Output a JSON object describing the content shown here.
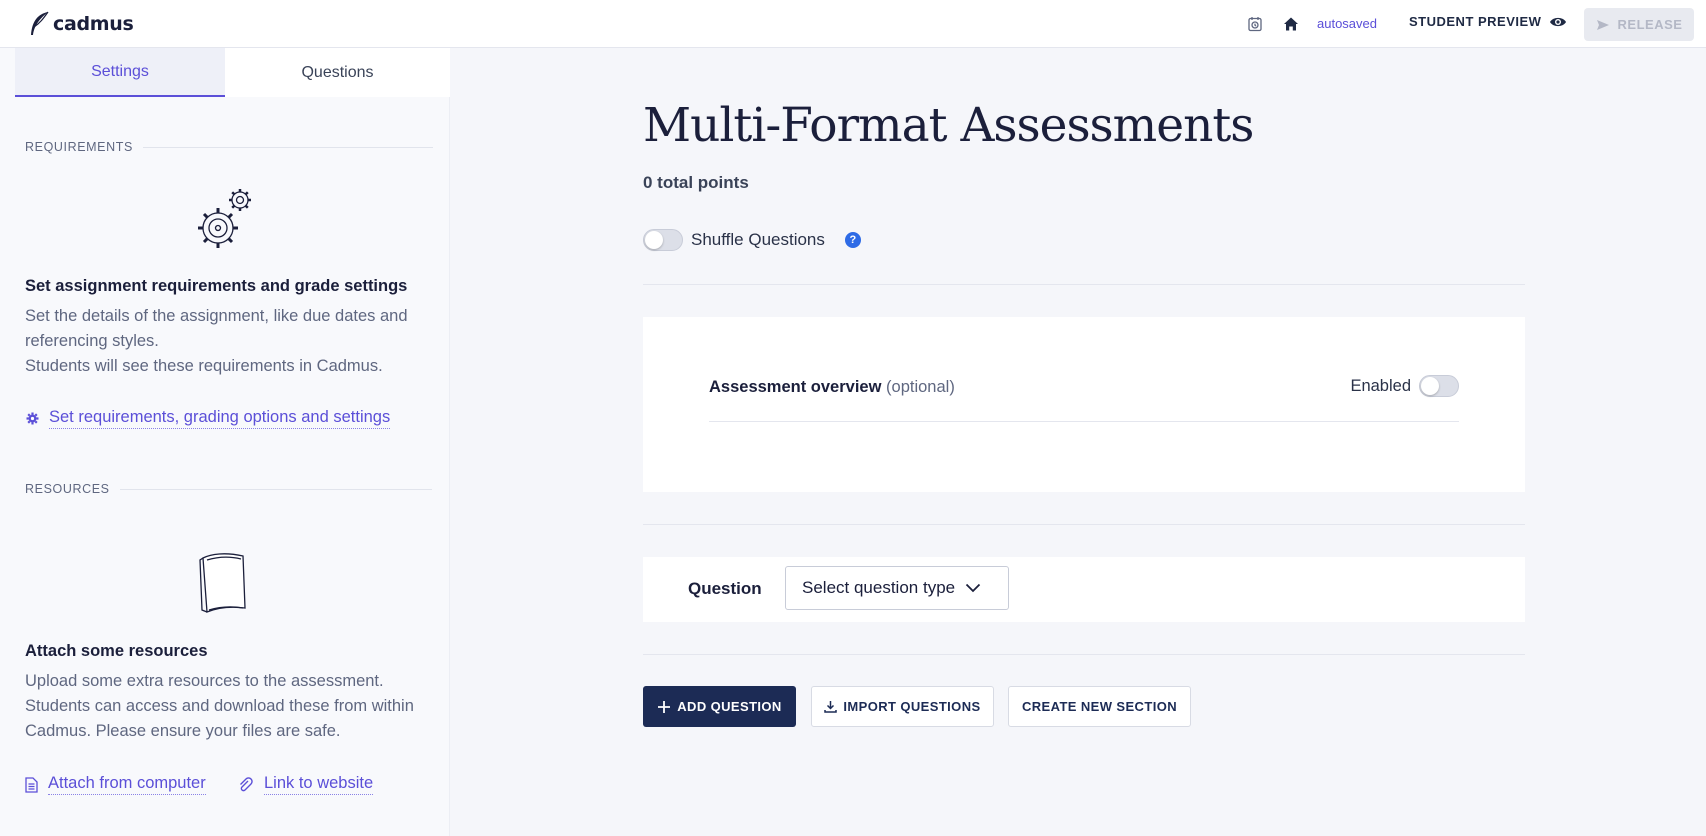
{
  "app": {
    "name": "cadmus"
  },
  "header": {
    "status": "autosaved",
    "preview_label": "STUDENT PREVIEW",
    "release_label": "RELEASE"
  },
  "sidebar": {
    "tabs": [
      {
        "label": "Settings",
        "active": true
      },
      {
        "label": "Questions",
        "active": false
      }
    ],
    "requirements": {
      "heading": "REQUIREMENTS",
      "title": "Set assignment requirements and grade settings",
      "desc_line1": "Set the details of the assignment, like due dates and referencing styles.",
      "desc_line2": "Students will see these requirements in Cadmus.",
      "link": "Set requirements, grading options and settings"
    },
    "resources": {
      "heading": "RESOURCES",
      "title": "Attach some resources",
      "desc": "Upload some extra resources to the assessment. Students can access and download these from within Cadmus. Please ensure your files are safe.",
      "link_attach": "Attach from computer",
      "link_website": "Link to website"
    }
  },
  "main": {
    "title": "Multi-Format Assessments",
    "points": "0 total points",
    "shuffle_label": "Shuffle Questions",
    "help": "?",
    "overview": {
      "label": "Assessment overview",
      "optional": "(optional)",
      "enabled_label": "Enabled"
    },
    "question": {
      "label": "Question",
      "select_placeholder": "Select question type"
    },
    "buttons": {
      "add": "ADD QUESTION",
      "import": "IMPORT QUESTIONS",
      "create_section": "CREATE NEW SECTION"
    }
  },
  "colors": {
    "accent": "#5b4fd8",
    "primary_button": "#1c2b55",
    "help": "#2e6be6"
  }
}
